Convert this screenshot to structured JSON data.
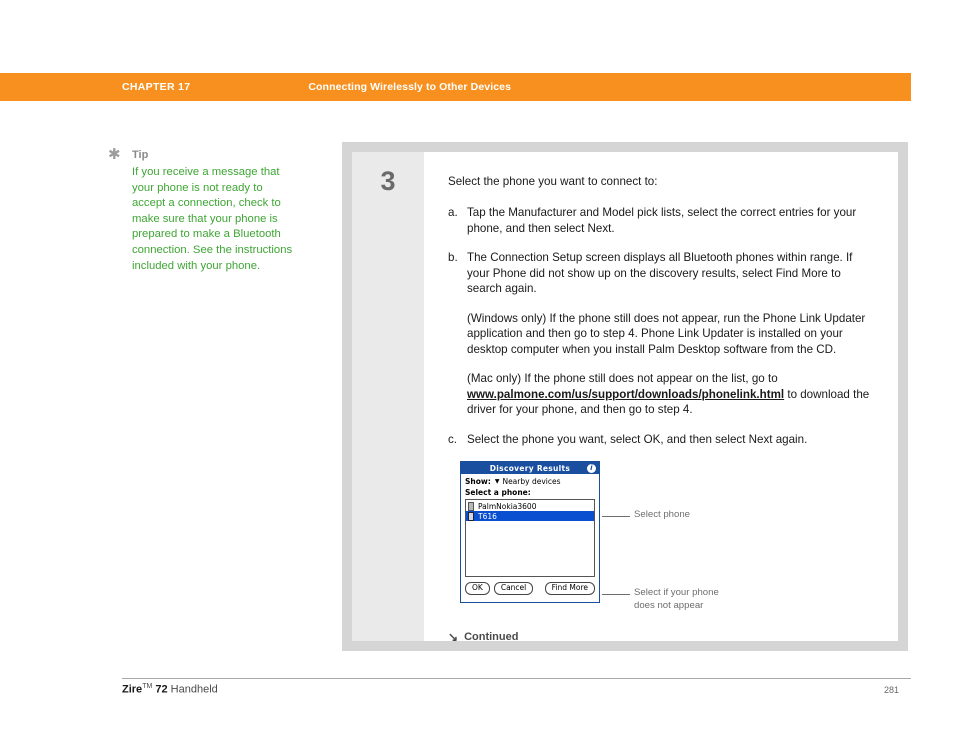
{
  "header": {
    "chapter_label": "CHAPTER 17",
    "chapter_title": "Connecting Wirelessly to Other Devices",
    "accent_color": "#F7901E"
  },
  "tip": {
    "star_icon": "asterisk-icon",
    "heading": "Tip",
    "body": "If you receive a message that your phone is not ready to accept a connection, check to make sure that your phone is prepared to make a Bluetooth connection. See the instructions included with your phone.",
    "text_color": "#3FA535"
  },
  "step": {
    "number": "3",
    "lead": "Select the phone you want to connect to:",
    "items": [
      {
        "marker": "a.",
        "text": "Tap the Manufacturer and Model pick lists, select the correct entries for your phone, and then select Next."
      },
      {
        "marker": "b.",
        "text": "The Connection Setup screen displays all Bluetooth phones within range. If your Phone did not show up on the discovery results, select Find More to search again."
      }
    ],
    "windows_para": "(Windows only) If the phone still does not appear, run the Phone Link Updater application and then go to step 4. Phone Link Updater is installed on your desktop computer when you install Palm Desktop software from the CD.",
    "mac_para_before": "(Mac only) If the phone still does not appear on the list, go to ",
    "mac_link": "www.palmone.com/us/support/downloads/phonelink.html",
    "mac_para_after": " to download the driver for your phone, and then go to step 4.",
    "item_c": {
      "marker": "c.",
      "text": "Select the phone you want, select OK, and then select Next again."
    },
    "continued_arrow": "arrow-down-right-icon",
    "continued_label": "Continued"
  },
  "pda": {
    "title": "Discovery Results",
    "info_icon": "info-icon",
    "title_bar_color": "#1a4fa0",
    "show_label": "Show:",
    "show_caret_icon": "caret-down-icon",
    "show_value": "Nearby devices",
    "select_label": "Select a phone:",
    "devices": [
      {
        "name": "PalmNokia3600",
        "selected": false
      },
      {
        "name": "T616",
        "selected": true
      }
    ],
    "buttons": [
      {
        "label": "OK"
      },
      {
        "label": "Cancel"
      },
      {
        "label": "Find More"
      }
    ]
  },
  "callouts": [
    {
      "text": "Select phone"
    },
    {
      "line1": "Select if your phone",
      "line2": "does not appear"
    }
  ],
  "footer": {
    "product_bold": "Zire",
    "tm": "TM",
    "model_bold": "72",
    "product_rest": " Handheld",
    "page_number": "281"
  }
}
